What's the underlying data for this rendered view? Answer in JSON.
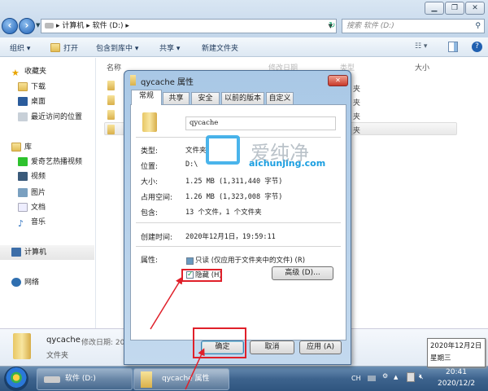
{
  "explorer": {
    "address": [
      "计算机",
      "软件 (D:)"
    ],
    "search_placeholder": "搜索 软件 (D:)",
    "toolbar": {
      "organize": "组织 ▾",
      "open": "打开",
      "include_library": "包含到库中 ▾",
      "share": "共享 ▾",
      "new_folder": "新建文件夹"
    },
    "columns": {
      "name": "名称",
      "modified": "修改日期",
      "type": "类型",
      "size": "大小"
    },
    "sidebar": {
      "favorites": "收藏夹",
      "favorites_items": [
        "下载",
        "桌面",
        "最近访问的位置"
      ],
      "libraries": "库",
      "library_items": [
        "爱奇艺热播视频",
        "视频",
        "图片",
        "文档",
        "音乐"
      ],
      "computer": "计算机",
      "network": "网络"
    },
    "file_types": [
      "夹",
      "夹",
      "夹",
      "夹"
    ],
    "details": {
      "name": "qycache",
      "modified": "修改日期: 20",
      "type": "文件夹"
    }
  },
  "dialog": {
    "title": "qycache 属性",
    "close": "✕",
    "tabs": [
      "常规",
      "共享",
      "安全",
      "以前的版本",
      "自定义"
    ],
    "folder_name": "qycache",
    "rows": [
      {
        "label": "类型:",
        "value": "文件夹"
      },
      {
        "label": "位置:",
        "value": "D:\\"
      },
      {
        "label": "大小:",
        "value": "1.25 MB (1,311,440 字节)"
      },
      {
        "label": "占用空间:",
        "value": "1.26 MB (1,323,008 字节)"
      },
      {
        "label": "包含:",
        "value": "13 个文件，1 个文件夹"
      }
    ],
    "created_label": "创建时间:",
    "created_value": "2020年12月1日，19:59:11",
    "attributes_label": "属性:",
    "readonly_label": "只读 (仅应用于文件夹中的文件) (R)",
    "hidden_label": "隐藏 (H)",
    "hidden_checked": true,
    "advanced": "高级 (D)...",
    "ok": "确定",
    "cancel": "取消",
    "apply": "应用 (A)"
  },
  "taskbar": {
    "items": [
      "软件 (D:)",
      "qycache 属性"
    ],
    "lang": "CH",
    "time": "20:41",
    "date": "2020/12/2"
  },
  "tooltip": {
    "date": "2020年12月2日",
    "weekday": "星期三"
  },
  "watermark": {
    "name": "爱纯净",
    "url": "aichunjing.com"
  }
}
